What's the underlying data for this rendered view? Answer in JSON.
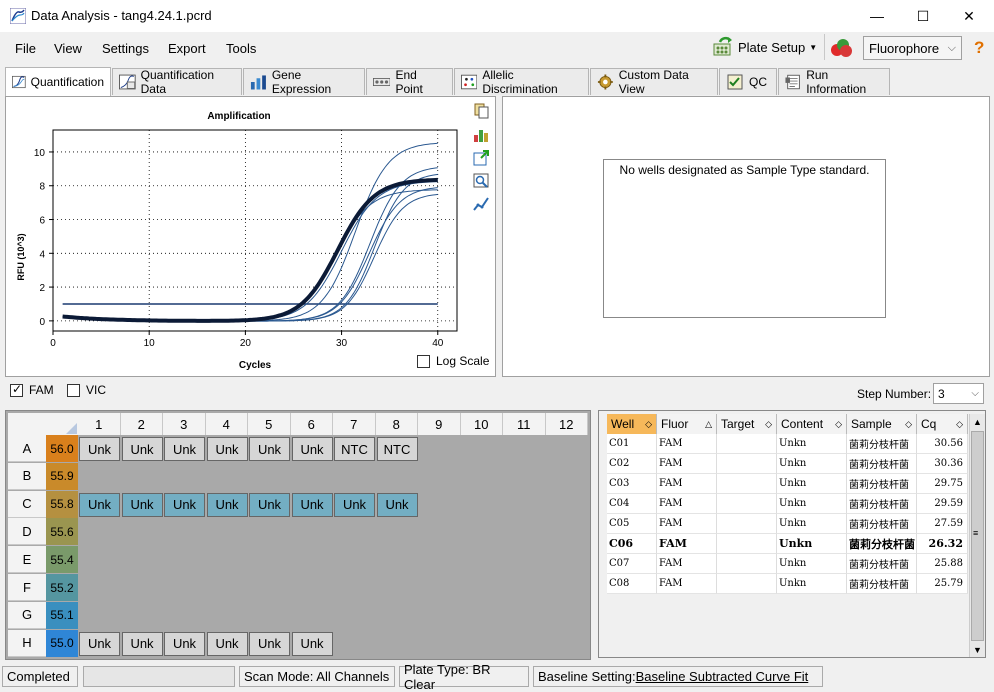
{
  "window": {
    "title": "Data Analysis - tang4.24.1.pcrd",
    "minimize": "—",
    "maximize": "☐",
    "close": "✕"
  },
  "menu": {
    "file": "File",
    "view": "View",
    "settings": "Settings",
    "export": "Export",
    "tools": "Tools"
  },
  "toolbar": {
    "plate_setup": "Plate Setup",
    "fluorophore": "Fluorophore",
    "help": "?"
  },
  "tabs": [
    "Quantification",
    "Quantification Data",
    "Gene Expression",
    "End Point",
    "Allelic Discrimination",
    "Custom Data View",
    "QC",
    "Run Information"
  ],
  "chart": {
    "title": "Amplification",
    "xlabel": "Cycles",
    "ylabel": "RFU (10^3)",
    "log_scale_label": "Log Scale",
    "xticks": [
      "0",
      "10",
      "20",
      "30",
      "40"
    ],
    "yticks": [
      "0",
      "2",
      "4",
      "6",
      "8",
      "10"
    ]
  },
  "chart_data": {
    "type": "line",
    "title": "Amplification",
    "xlabel": "Cycles",
    "ylabel": "RFU (10^3)",
    "xlim": [
      0,
      42
    ],
    "ylim": [
      -0.6,
      11.3
    ],
    "grid": true,
    "threshold": 1.0,
    "series": [
      {
        "cq": 25.79,
        "plateau": 8.4,
        "slope": 1.9,
        "emph": true
      },
      {
        "cq": 25.88,
        "plateau": 7.8,
        "slope": 1.8
      },
      {
        "cq": 26.32,
        "plateau": 8.3,
        "slope": 1.85
      },
      {
        "cq": 27.59,
        "plateau": 10.6,
        "slope": 1.7
      },
      {
        "cq": 29.59,
        "plateau": 9.2,
        "slope": 1.6
      },
      {
        "cq": 29.75,
        "plateau": 8.0,
        "slope": 1.6
      },
      {
        "cq": 30.36,
        "plateau": 8.8,
        "slope": 1.5
      },
      {
        "cq": 30.56,
        "plateau": 7.6,
        "slope": 1.5
      }
    ]
  },
  "standard_pane": {
    "message": "No wells designated as Sample Type standard."
  },
  "fluor_filter": {
    "fam": "FAM",
    "vic": "VIC",
    "fam_checked": true,
    "vic_checked": false
  },
  "step": {
    "label": "Step Number:",
    "value": "3"
  },
  "plate": {
    "columns": [
      "1",
      "2",
      "3",
      "4",
      "5",
      "6",
      "7",
      "8",
      "9",
      "10",
      "11",
      "12"
    ],
    "rows": [
      {
        "label": "A",
        "temp": "56.0",
        "color": "#d9801c",
        "wells": [
          "Unk",
          "Unk",
          "Unk",
          "Unk",
          "Unk",
          "Unk",
          "NTC",
          "NTC"
        ],
        "style": "g"
      },
      {
        "label": "B",
        "temp": "55.9",
        "color": "#c98a2a",
        "wells": [],
        "style": "g"
      },
      {
        "label": "C",
        "temp": "55.8",
        "color": "#b59040",
        "wells": [
          "Unk",
          "Unk",
          "Unk",
          "Unk",
          "Unk",
          "Unk",
          "Unk",
          "Unk"
        ],
        "style": "b"
      },
      {
        "label": "D",
        "temp": "55.6",
        "color": "#9a9550",
        "wells": [],
        "style": "g"
      },
      {
        "label": "E",
        "temp": "55.4",
        "color": "#7a9a6a",
        "wells": [],
        "style": "g"
      },
      {
        "label": "F",
        "temp": "55.2",
        "color": "#5596a0",
        "wells": [],
        "style": "g"
      },
      {
        "label": "G",
        "temp": "55.1",
        "color": "#3a8fbf",
        "wells": [],
        "style": "g"
      },
      {
        "label": "H",
        "temp": "55.0",
        "color": "#2f86d6",
        "wells": [
          "Unk",
          "Unk",
          "Unk",
          "Unk",
          "Unk",
          "Unk"
        ],
        "style": "g"
      }
    ]
  },
  "table": {
    "headers": [
      "Well",
      "Fluor",
      "Target",
      "Content",
      "Sample",
      "Cq"
    ],
    "rows": [
      {
        "well": "C01",
        "fluor": "FAM",
        "target": "",
        "content": "Unkn",
        "sample": "菌莉分枝杆菌",
        "cq": "30.56",
        "bold": false
      },
      {
        "well": "C02",
        "fluor": "FAM",
        "target": "",
        "content": "Unkn",
        "sample": "菌莉分枝杆菌",
        "cq": "30.36",
        "bold": false
      },
      {
        "well": "C03",
        "fluor": "FAM",
        "target": "",
        "content": "Unkn",
        "sample": "菌莉分枝杆菌",
        "cq": "29.75",
        "bold": false
      },
      {
        "well": "C04",
        "fluor": "FAM",
        "target": "",
        "content": "Unkn",
        "sample": "菌莉分枝杆菌",
        "cq": "29.59",
        "bold": false
      },
      {
        "well": "C05",
        "fluor": "FAM",
        "target": "",
        "content": "Unkn",
        "sample": "菌莉分枝杆菌",
        "cq": "27.59",
        "bold": false
      },
      {
        "well": "C06",
        "fluor": "FAM",
        "target": "",
        "content": "Unkn",
        "sample": "菌莉分枝杆菌",
        "cq": "26.32",
        "bold": true
      },
      {
        "well": "C07",
        "fluor": "FAM",
        "target": "",
        "content": "Unkn",
        "sample": "菌莉分枝杆菌",
        "cq": "25.88",
        "bold": false
      },
      {
        "well": "C08",
        "fluor": "FAM",
        "target": "",
        "content": "Unkn",
        "sample": "菌莉分枝杆菌",
        "cq": "25.79",
        "bold": false
      }
    ]
  },
  "status": {
    "state": "Completed",
    "scan_mode": "Scan Mode: All Channels",
    "plate_type": "Plate Type: BR Clear",
    "baseline_prefix": "Baseline Setting: ",
    "baseline_value": "Baseline Subtracted Curve Fit"
  }
}
